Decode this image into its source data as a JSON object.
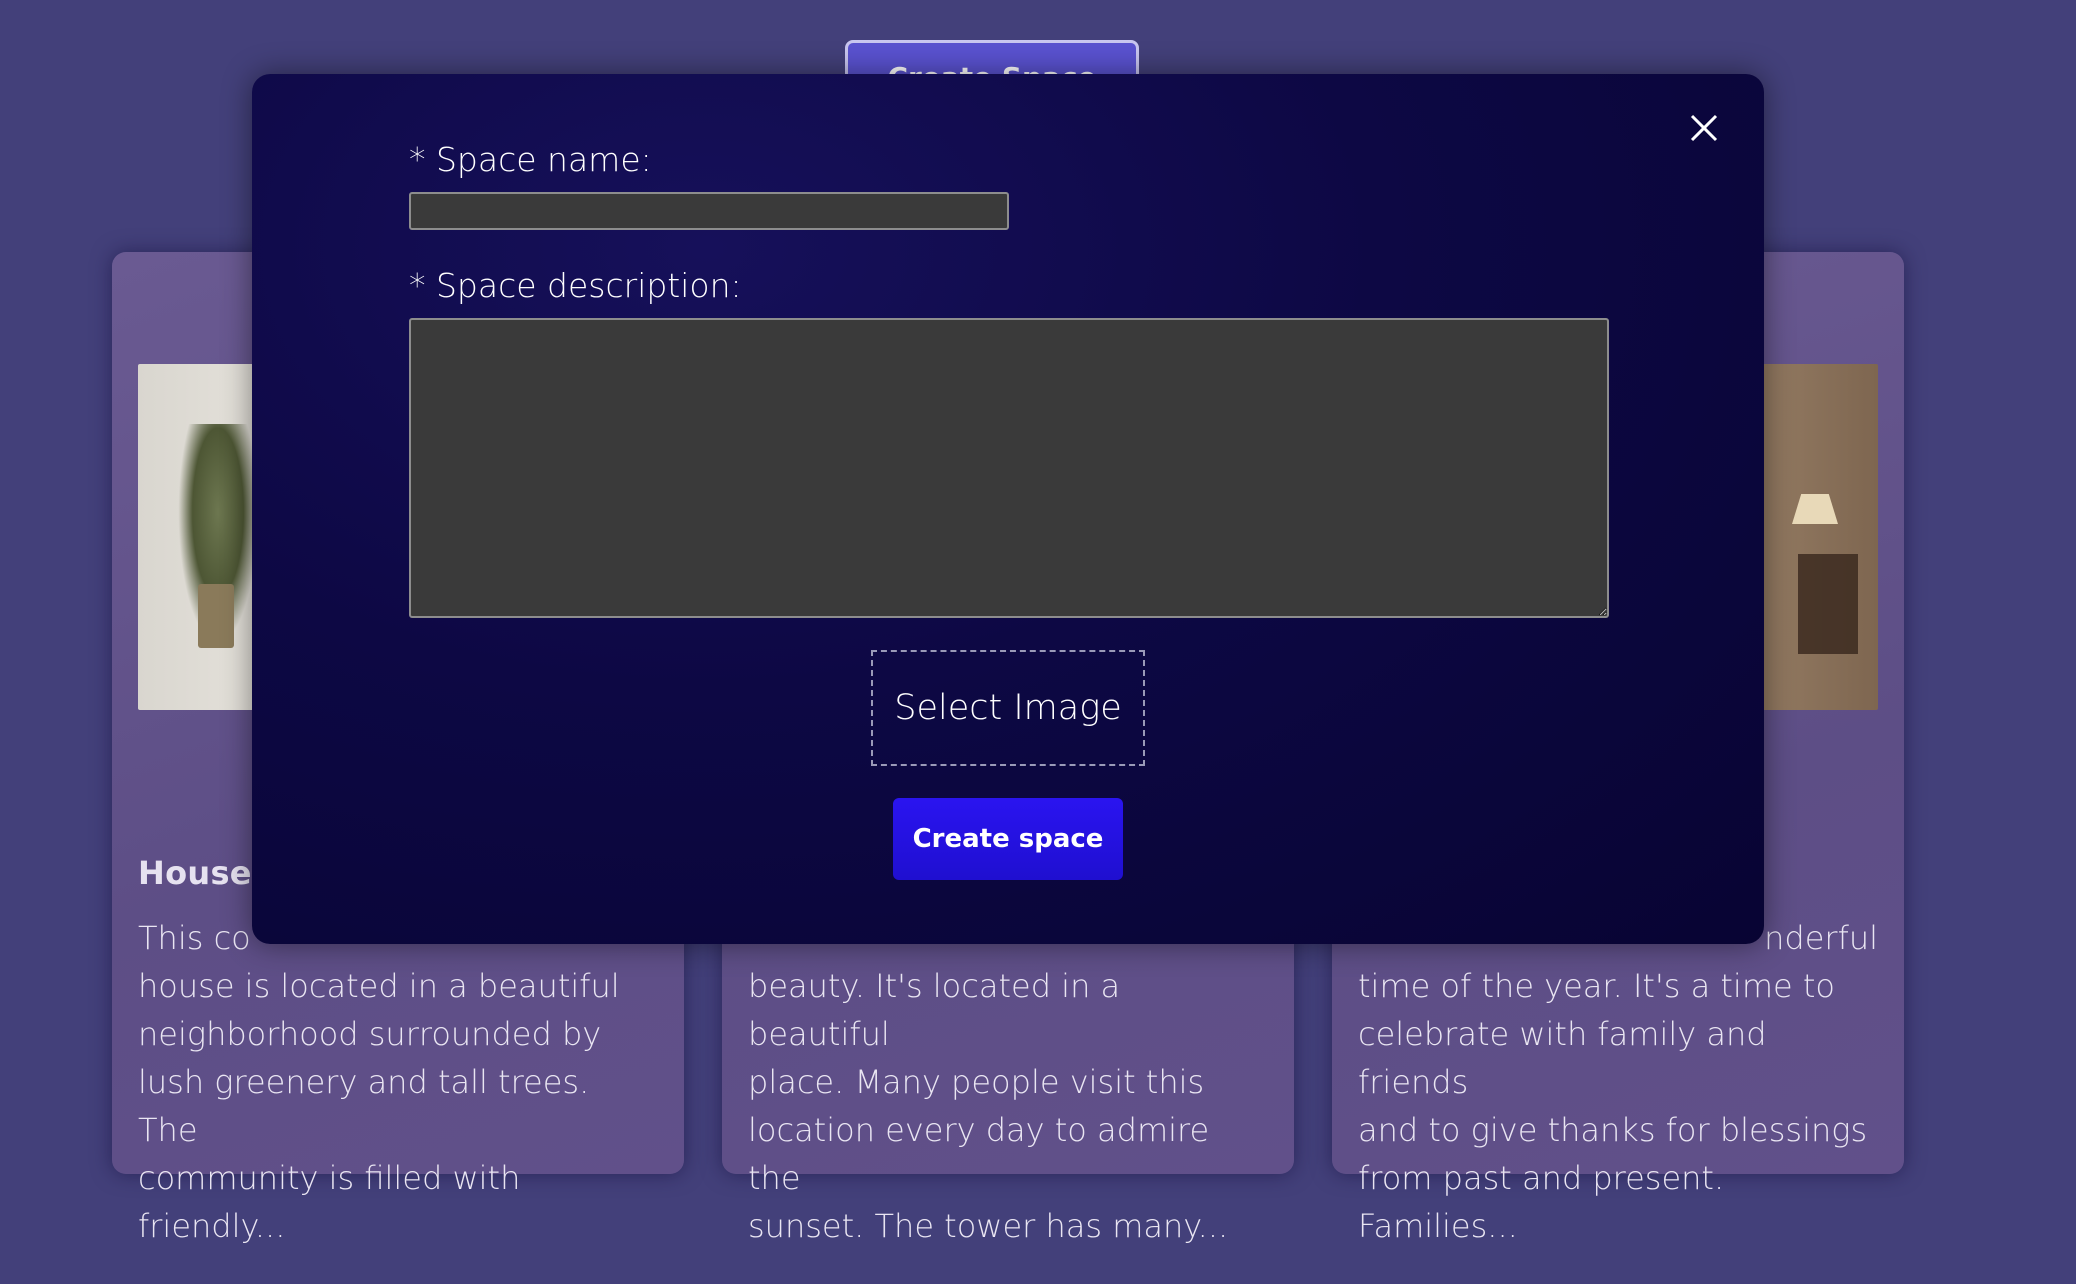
{
  "top_button": {
    "label": "Create Space"
  },
  "cards": [
    {
      "title": "House I",
      "description": "This cozy and comfortable house is located in a beautiful neighborhood surrounded by lush greenery and tall trees. The community is filled with friendly..."
    },
    {
      "title": "",
      "description": "...beauty. It's located in a beautiful place. Many people visit this location every day to admire the sunset. The tower has many..."
    },
    {
      "title": "",
      "description": "...wonderful time of the year. It's a time to celebrate with family and friends and to give thanks for blessings from past and present. Families..."
    }
  ],
  "card_text_visible": [
    {
      "title": "House I",
      "lines": [
        "This co",
        "house is located in a beautiful",
        "neighborhood surrounded by",
        "lush greenery and tall trees. The",
        "community is filled with friendly..."
      ]
    },
    {
      "lines": [
        "",
        "beauty. It's located in a beautiful",
        "place. Many people visit this",
        "location every day to admire the",
        "sunset. The tower has many..."
      ]
    },
    {
      "lines": [
        "nderful",
        "time of the year. It's a time to",
        "celebrate with family and friends",
        "and to give thanks for blessings",
        "from past and present. Families..."
      ]
    }
  ],
  "modal": {
    "close_icon": "close-icon",
    "space_name_label": "* Space name:",
    "space_name_value": "",
    "space_description_label": "* Space description:",
    "space_description_value": "",
    "select_image_label": "Select Image",
    "create_space_label": "Create space"
  },
  "colors": {
    "page_background": "#43407a",
    "modal_background": "#0d0844",
    "primary_button": "#2a14f0",
    "input_background": "#3a3a3a"
  }
}
